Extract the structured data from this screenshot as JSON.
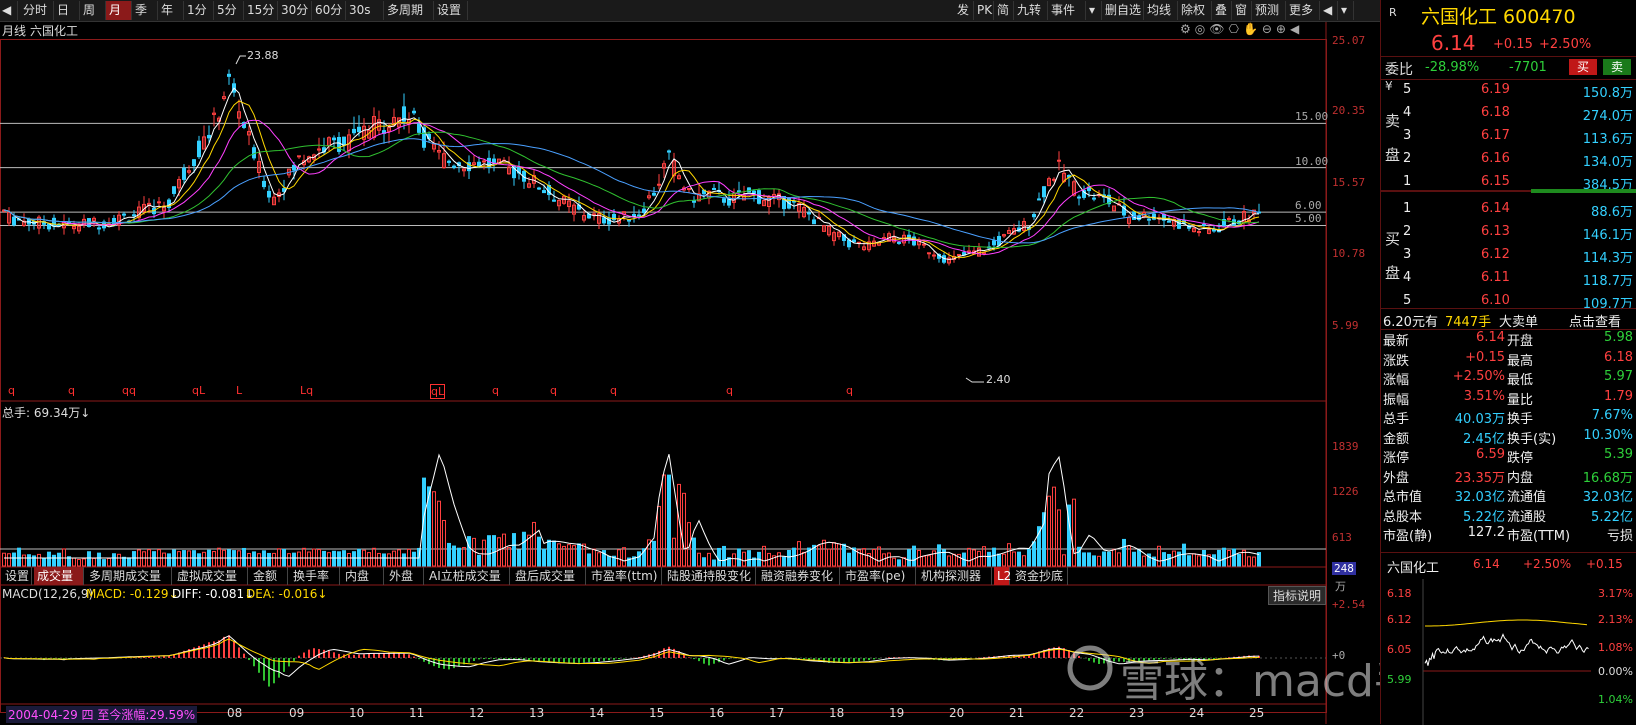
{
  "toolbar": {
    "left": [
      "分时",
      "日",
      "周",
      "月",
      "季",
      "年",
      "1分",
      "5分",
      "15分",
      "30分",
      "60分",
      "30s",
      "多周期",
      "设置"
    ],
    "selected_index": 3,
    "right": [
      "发",
      "PK",
      "简",
      "九转",
      "事件",
      "删自选",
      "均线",
      "除权",
      "叠",
      "窗",
      "预测",
      "更多"
    ]
  },
  "chart_title": {
    "period": "月线",
    "name": "六国化工"
  },
  "price_axis": [
    "25.07",
    "20.35",
    "15.57",
    "10.78",
    "5.99"
  ],
  "price_levels": [
    {
      "value": 15.0,
      "label": "15.00"
    },
    {
      "value": 10.0,
      "label": "10.00"
    },
    {
      "value": 6.0,
      "label": "6.00"
    },
    {
      "value": 5.0,
      "label": "5.00"
    }
  ],
  "annotations": {
    "high": "23.88",
    "low": "2.40"
  },
  "event_markers": [
    "q",
    "q",
    "qq",
    "qL",
    "L",
    "Lq",
    "qL",
    "q",
    "q",
    "q",
    "q",
    "q",
    "q"
  ],
  "volume": {
    "label": "总手: 69.34万↓",
    "axis": [
      "1839",
      "1226",
      "613",
      "248"
    ],
    "unit": "万"
  },
  "indicator_tabs": [
    "设置",
    "成交量",
    "多周期成交量",
    "虚拟成交量",
    "金额",
    "换手率",
    "内盘",
    "外盘",
    "AI立桩成交量",
    "盘后成交量",
    "市盈率(ttm)",
    "陆股通持股变化",
    "融资融券变化",
    "市盈率(pe)",
    "机构探测器",
    "L2",
    "资金抄底"
  ],
  "selected_tab_index": 1,
  "macd": {
    "label": "MACD(12,26,9)",
    "macd": "MACD: -0.129↓",
    "diff": "DIFF: -0.081↓",
    "dea": "DEA: -0.016↓",
    "axis_top": "+2.54",
    "axis_zero": "+0",
    "help": "指标说明"
  },
  "time_axis": [
    "08",
    "09",
    "10",
    "11",
    "12",
    "13",
    "14",
    "15",
    "16",
    "17",
    "18",
    "19",
    "20",
    "21",
    "22",
    "23",
    "24",
    "25"
  ],
  "range_info": "2004-04-29 四 至今涨幅:29.59%",
  "quote": {
    "code_prefix": "R",
    "title": "六国化工 600470",
    "price": "6.14",
    "change": "+0.15",
    "pct": "+2.50%",
    "weibi_label": "委比",
    "weibi": "-28.98%",
    "weicha": "-7701",
    "buy_btn": "买",
    "sell_btn": "卖",
    "sell_label": "卖盘",
    "buy_label": "买盘",
    "yen": "¥",
    "sells": [
      {
        "lvl": "5",
        "price": "6.19",
        "vol": "150.8万"
      },
      {
        "lvl": "4",
        "price": "6.18",
        "vol": "274.0万"
      },
      {
        "lvl": "3",
        "price": "6.17",
        "vol": "113.6万"
      },
      {
        "lvl": "2",
        "price": "6.16",
        "vol": "134.0万"
      },
      {
        "lvl": "1",
        "price": "6.15",
        "vol": "384.5万"
      }
    ],
    "buys": [
      {
        "lvl": "1",
        "price": "6.14",
        "vol": "88.6万"
      },
      {
        "lvl": "2",
        "price": "6.13",
        "vol": "146.1万"
      },
      {
        "lvl": "3",
        "price": "6.12",
        "vol": "114.3万"
      },
      {
        "lvl": "4",
        "price": "6.11",
        "vol": "118.7万"
      },
      {
        "lvl": "5",
        "price": "6.10",
        "vol": "109.7万"
      }
    ],
    "big_order": {
      "a": "6.20元有",
      "b": "7447手",
      "c": "大卖单",
      "d": "点击查看"
    },
    "stats": [
      [
        "最新",
        "6.14",
        "开盘",
        "5.98"
      ],
      [
        "涨跌",
        "+0.15",
        "最高",
        "6.18"
      ],
      [
        "涨幅",
        "+2.50%",
        "最低",
        "5.97"
      ],
      [
        "振幅",
        "3.51%",
        "量比",
        "1.79"
      ],
      [
        "总手",
        "40.03万",
        "换手",
        "7.67%"
      ],
      [
        "金额",
        "2.45亿",
        "换手(实)",
        "10.30%"
      ],
      [
        "涨停",
        "6.59",
        "跌停",
        "5.39"
      ],
      [
        "外盘",
        "23.35万",
        "内盘",
        "16.68万"
      ],
      [
        "总市值",
        "32.03亿",
        "流通值",
        "32.03亿"
      ],
      [
        "总股本",
        "5.22亿",
        "流通股",
        "5.22亿"
      ],
      [
        "市盈(静)",
        "127.2",
        "市盈(TTM)",
        "亏损"
      ]
    ],
    "mini": {
      "name": "六国化工",
      "price": "6.14",
      "pct": "+2.50%",
      "chg": "+0.15",
      "left_axis": [
        "6.18",
        "6.12",
        "6.05",
        "5.99"
      ],
      "right_axis": [
        "3.17%",
        "2.13%",
        "1.08%",
        "0.00%",
        "1.04%"
      ]
    }
  },
  "watermark": "雪球：macd手术刀",
  "colors": {
    "up": "#ff4040",
    "down": "#33d0ff",
    "ma_white": "#ffffff",
    "ma_yellow": "#ffd800",
    "ma_magenta": "#ff40ff",
    "ma_green": "#30c030"
  }
}
